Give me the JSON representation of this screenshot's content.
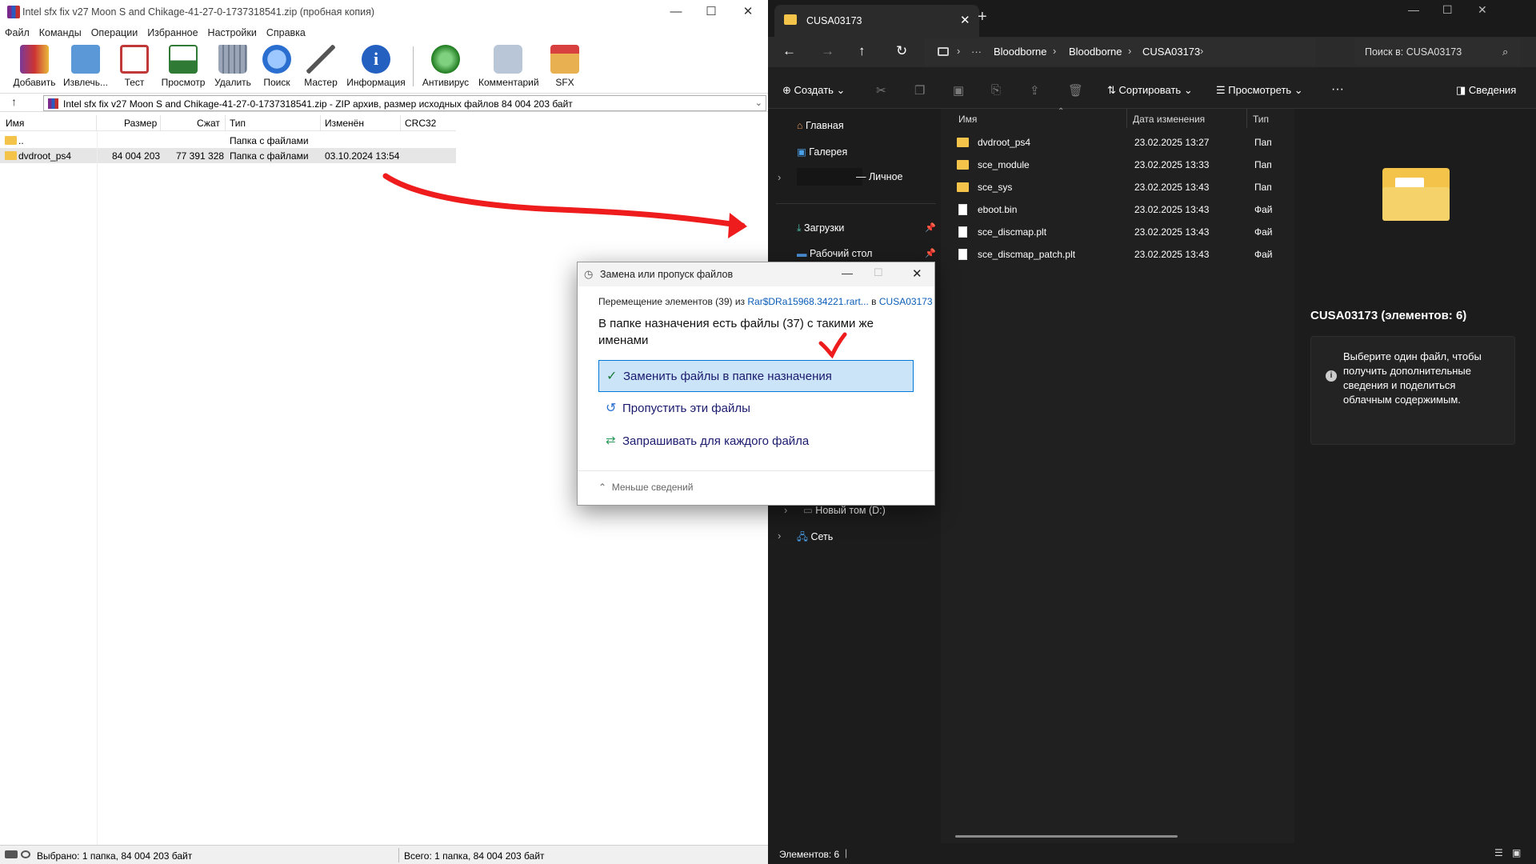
{
  "winrar": {
    "title": "Intel sfx fix v27 Moon S and Chikage-41-27-0-1737318541.zip (пробная копия)",
    "menu": [
      "Файл",
      "Команды",
      "Операции",
      "Избранное",
      "Настройки",
      "Справка"
    ],
    "toolbar": [
      {
        "label": "Добавить",
        "icon": "add-books-icon",
        "color": "#c23a3a"
      },
      {
        "label": "Извлечь...",
        "icon": "extract-folder-icon",
        "color": "#4a86c8"
      },
      {
        "label": "Тест",
        "icon": "test-clipboard-icon",
        "color": "#c04040"
      },
      {
        "label": "Просмотр",
        "icon": "view-book-icon",
        "color": "#2f7a34"
      },
      {
        "label": "Удалить",
        "icon": "trash-icon",
        "color": "#8a94a6"
      },
      {
        "label": "Поиск",
        "icon": "magnifier-icon",
        "color": "#2a6fd0"
      },
      {
        "label": "Мастер",
        "icon": "wizard-wand-icon",
        "color": "#6a6a6a"
      },
      {
        "label": "Информация",
        "icon": "info-icon",
        "color": "#2460c0"
      },
      {
        "label": "Антивирус",
        "icon": "antivirus-bug-icon",
        "color": "#2e9a2e"
      },
      {
        "label": "Комментарий",
        "icon": "comment-icon",
        "color": "#7a8ca8"
      },
      {
        "label": "SFX",
        "icon": "sfx-box-icon",
        "color": "#c87a2a"
      }
    ],
    "path": "Intel sfx fix v27 Moon S and Chikage-41-27-0-1737318541.zip - ZIP архив, размер исходных файлов 84 004 203 байт",
    "columns": {
      "name": "Имя",
      "size": "Размер",
      "packed": "Сжат",
      "type": "Тип",
      "modified": "Изменён",
      "crc": "CRC32"
    },
    "rows": [
      {
        "name": "..",
        "size": "",
        "packed": "",
        "type": "Папка с файлами",
        "modified": ""
      },
      {
        "name": "dvdroot_ps4",
        "size": "84 004 203",
        "packed": "77 391 328",
        "type": "Папка с файлами",
        "modified": "03.10.2024 13:54"
      }
    ],
    "status_left": "Выбрано: 1 папка, 84 004 203 байт",
    "status_right": "Всего: 1 папка, 84 004 203 байт"
  },
  "explorer": {
    "tab_title": "CUSA03173",
    "breadcrumb": [
      "Bloodborne",
      "Bloodborne",
      "CUSA03173"
    ],
    "breadcrumb_more": "···",
    "search_placeholder": "Поиск в: CUSA03173",
    "cmd": {
      "create": "Создать",
      "sort": "Сортировать",
      "view": "Просмотреть",
      "more": "···",
      "details": "Сведения"
    },
    "sidebar": {
      "home": "Главная",
      "gallery": "Галерея",
      "personal": "— Личное",
      "downloads": "Загрузки",
      "desktop": "Рабочий стол",
      "drive_d": "Новый том (D:)",
      "network": "Сеть"
    },
    "columns": {
      "name": "Имя",
      "modified": "Дата изменения",
      "type": "Тип"
    },
    "files": [
      {
        "name": "dvdroot_ps4",
        "date": "23.02.2025 13:27",
        "type": "Пап",
        "kind": "folder"
      },
      {
        "name": "sce_module",
        "date": "23.02.2025 13:33",
        "type": "Пап",
        "kind": "folder"
      },
      {
        "name": "sce_sys",
        "date": "23.02.2025 13:43",
        "type": "Пап",
        "kind": "folder"
      },
      {
        "name": "eboot.bin",
        "date": "23.02.2025 13:43",
        "type": "Фай",
        "kind": "file"
      },
      {
        "name": "sce_discmap.plt",
        "date": "23.02.2025 13:43",
        "type": "Фай",
        "kind": "file"
      },
      {
        "name": "sce_discmap_patch.plt",
        "date": "23.02.2025 13:43",
        "type": "Фай",
        "kind": "file"
      }
    ],
    "details_title": "CUSA03173 (элементов: 6)",
    "details_info": "Выберите один файл, чтобы получить дополнительные сведения и поделиться облачным содержимым.",
    "status": "Элементов: 6"
  },
  "dialog": {
    "title": "Замена или пропуск файлов",
    "move_prefix": "Перемещение элементов (39) из",
    "move_source": "Rar$DRa15968.34221.rart...",
    "move_mid": "в",
    "move_dest": "CUSA03173",
    "heading": "В папке назначения есть файлы (37) с такими же именами",
    "option_replace": "Заменить файлы в папке назначения",
    "option_skip": "Пропустить эти файлы",
    "option_ask": "Запрашивать для каждого файла",
    "less_details": "Меньше сведений"
  },
  "colors": {
    "accent": "#0078d7",
    "annotation": "#ee1c1c",
    "folder": "#f3c34a"
  }
}
